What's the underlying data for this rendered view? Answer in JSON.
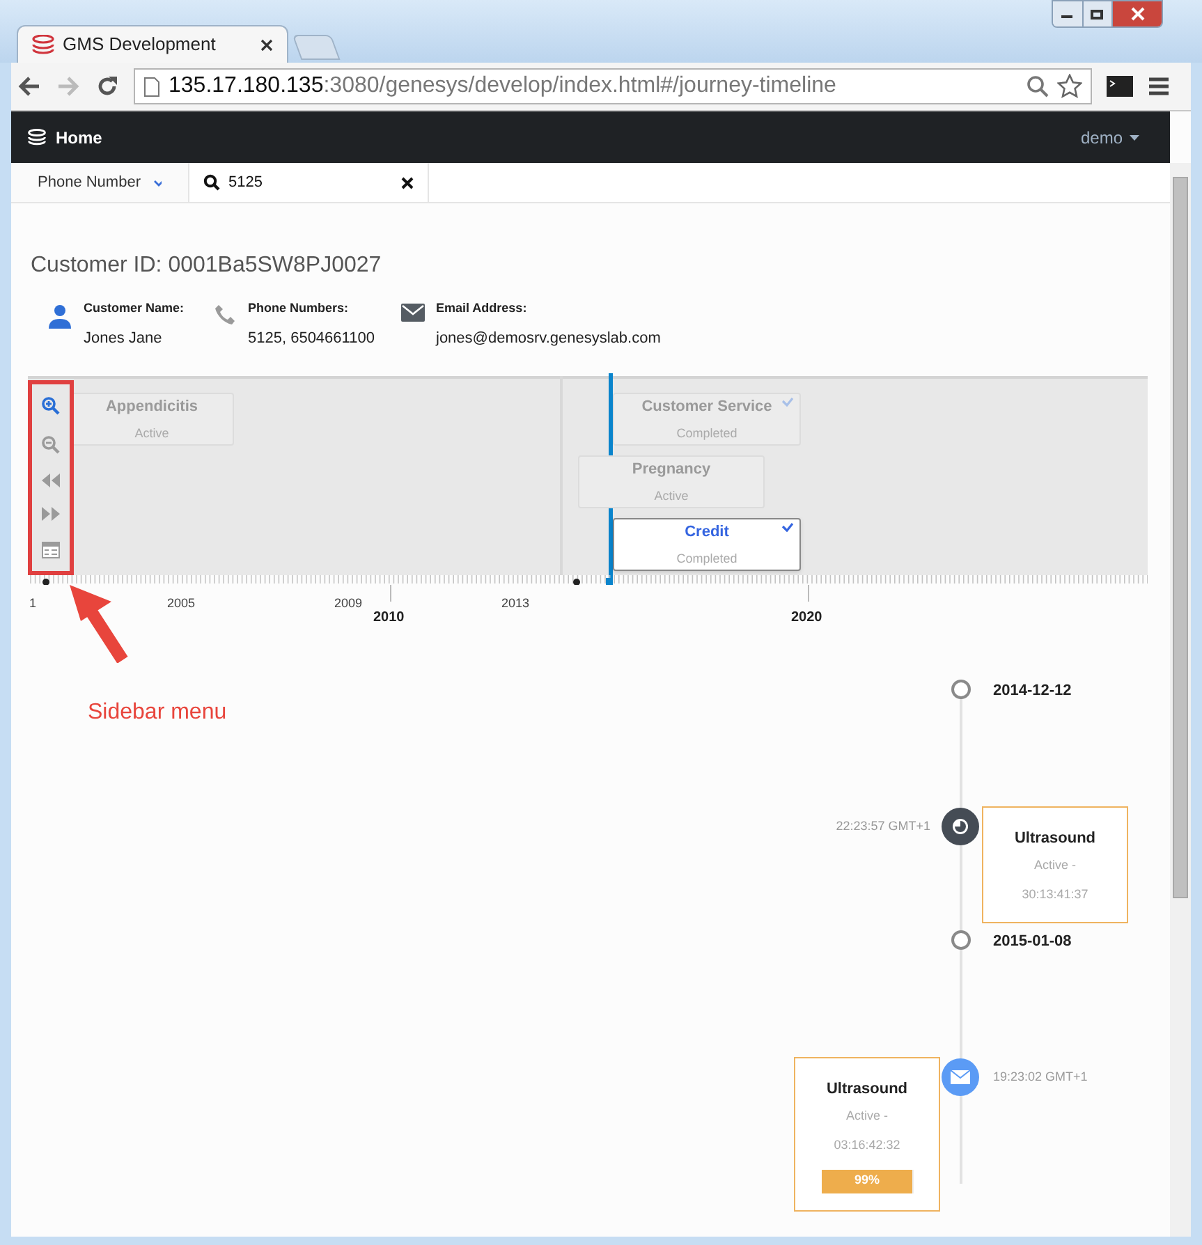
{
  "window": {
    "tab_title": "GMS Development",
    "url_host": "135.17.180.135",
    "url_rest": ":3080/genesys/develop/index.html#/journey-timeline"
  },
  "navbar": {
    "brand": "Home",
    "user": "demo"
  },
  "search": {
    "filter": "Phone Number",
    "value": "5125"
  },
  "customer": {
    "title": "Customer ID: 0001Ba5SW8PJ0027",
    "fields": [
      {
        "kind": "person",
        "label": "Customer Name:",
        "value": "Jones Jane"
      },
      {
        "kind": "phone",
        "label": "Phone Numbers:",
        "value": "5125, 6504661100"
      },
      {
        "kind": "email",
        "label": "Email Address:",
        "value": "jones@demosrv.genesyslab.com"
      }
    ]
  },
  "sidebar_menu": [
    {
      "kind": "zoom-in",
      "active": true
    },
    {
      "kind": "zoom-out",
      "active": false
    },
    {
      "kind": "rewind",
      "active": false
    },
    {
      "kind": "forward",
      "active": false
    },
    {
      "kind": "calendar",
      "active": false
    }
  ],
  "journeys": [
    {
      "name": "Appendicitis",
      "status": "Active",
      "selected": false,
      "checked": false
    },
    {
      "name": "Customer Service",
      "status": "Completed",
      "selected": false,
      "checked": true
    },
    {
      "name": "Pregnancy",
      "status": "Active",
      "selected": false,
      "checked": false
    },
    {
      "name": "Credit",
      "status": "Completed",
      "selected": true,
      "checked": true
    }
  ],
  "axis_labels": [
    {
      "text": "1",
      "major": false
    },
    {
      "text": "2005",
      "major": false
    },
    {
      "text": "2009",
      "major": false
    },
    {
      "text": "2013",
      "major": false
    },
    {
      "text": "2010",
      "major": true
    },
    {
      "text": "2020",
      "major": true
    }
  ],
  "timeline": [
    {
      "kind": "date",
      "text": "2014-12-12"
    },
    {
      "kind": "activity",
      "time": "22:23:57 GMT+1",
      "title": "Ultrasound",
      "status": "Active -",
      "duration": "30:13:41:37"
    },
    {
      "kind": "date",
      "text": "2015-01-08"
    },
    {
      "kind": "message",
      "time": "19:23:02 GMT+1",
      "title": "Ultrasound",
      "status": "Active -",
      "duration": "03:16:42:32",
      "progress": "99%",
      "level": 0.99
    }
  ],
  "annotation": {
    "label": "Sidebar menu"
  }
}
